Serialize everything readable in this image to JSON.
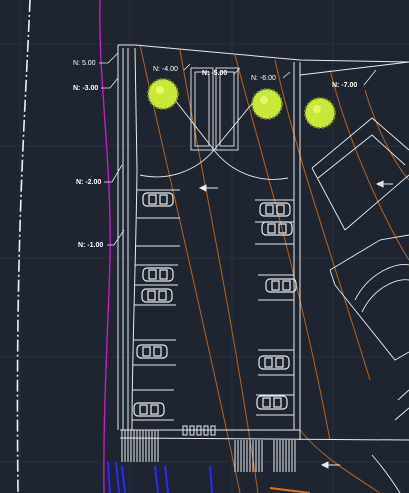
{
  "colors": {
    "background": "#1e2530",
    "grid": "#2e3846",
    "linework": "#e8ecf0",
    "contour": "#b8621e",
    "boundary": "#c21cc2",
    "trees": "#c8e83a",
    "drainage": "#2a2aff"
  },
  "icons": {
    "tree": "tree-symbol-icon",
    "car": "car-symbol-icon",
    "flow_arrow": "flow-arrow-icon"
  },
  "elevation_labels": [
    {
      "id": "n-5",
      "text": "N: 5.00"
    },
    {
      "id": "n-3",
      "text": "N: -3.00"
    },
    {
      "id": "n-4",
      "text": "N: -4.00"
    },
    {
      "id": "n-5b",
      "text": "N: -5.00"
    },
    {
      "id": "n-6",
      "text": "N: -6.00"
    },
    {
      "id": "n-7",
      "text": "N: -7.00"
    },
    {
      "id": "n-2",
      "text": "N: -2.00"
    },
    {
      "id": "n-1",
      "text": "N: -1.00"
    }
  ]
}
